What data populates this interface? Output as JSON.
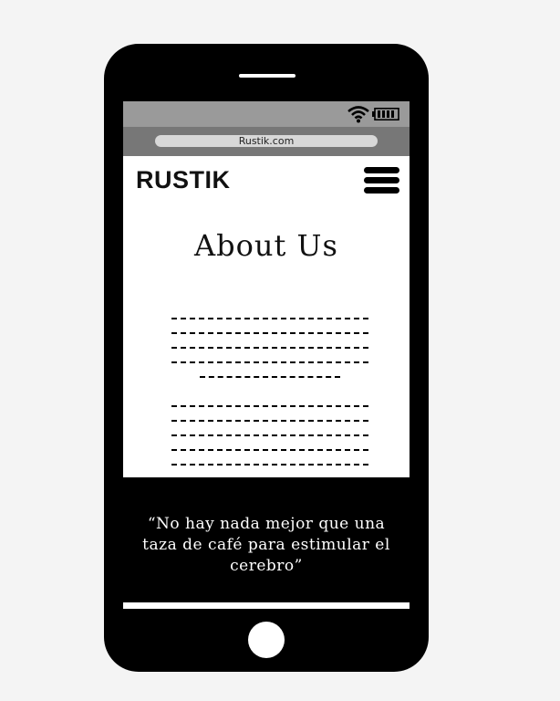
{
  "browser": {
    "url": "Rustik.com"
  },
  "header": {
    "logo": "RUSTIK"
  },
  "content": {
    "title": "About Us"
  },
  "footer": {
    "quote_lines": [
      "“No hay nada mejor que una",
      "taza de café para estimular el",
      "cerebro”"
    ]
  },
  "icons": {
    "status": [
      "wifi-icon",
      "battery-icon"
    ],
    "nav": "hamburger-menu-icon"
  },
  "colors": {
    "device": "#000000",
    "status_bar": "#9a9a9a",
    "url_bar": "#777777",
    "screen": "#ffffff"
  }
}
